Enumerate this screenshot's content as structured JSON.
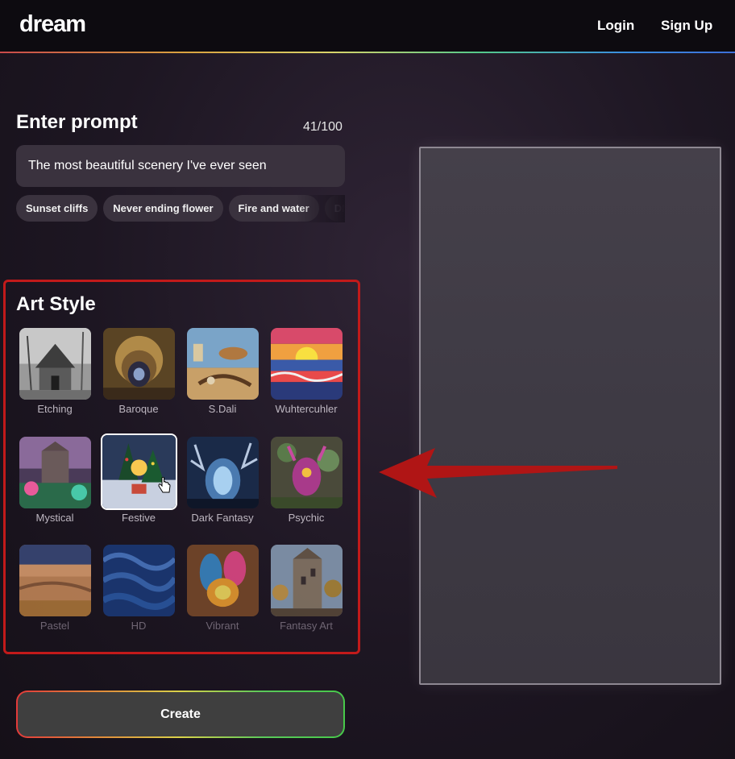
{
  "header": {
    "logo": "dream",
    "login": "Login",
    "signup": "Sign Up"
  },
  "prompt": {
    "title": "Enter prompt",
    "count": "41/100",
    "value": "The most beautiful scenery I've ever seen",
    "chips": [
      "Sunset cliffs",
      "Never ending flower",
      "Fire and water",
      "DNA tornado"
    ]
  },
  "art_style": {
    "title": "Art Style",
    "selected": "Festive",
    "styles": [
      {
        "label": "Etching"
      },
      {
        "label": "Baroque"
      },
      {
        "label": "S.Dali"
      },
      {
        "label": "Wuhtercuhler"
      },
      {
        "label": "Mystical"
      },
      {
        "label": "Festive"
      },
      {
        "label": "Dark Fantasy"
      },
      {
        "label": "Psychic"
      },
      {
        "label": "Pastel"
      },
      {
        "label": "HD"
      },
      {
        "label": "Vibrant"
      },
      {
        "label": "Fantasy Art"
      }
    ]
  },
  "create": {
    "label": "Create"
  },
  "colors": {
    "highlight_border": "#c21a1a",
    "arrow": "#b01515",
    "background": "#1d1622",
    "chip_bg": "#3a323e"
  },
  "icons": {
    "pointer": "hand-pointer-icon",
    "annotation": "red-arrow-icon"
  }
}
